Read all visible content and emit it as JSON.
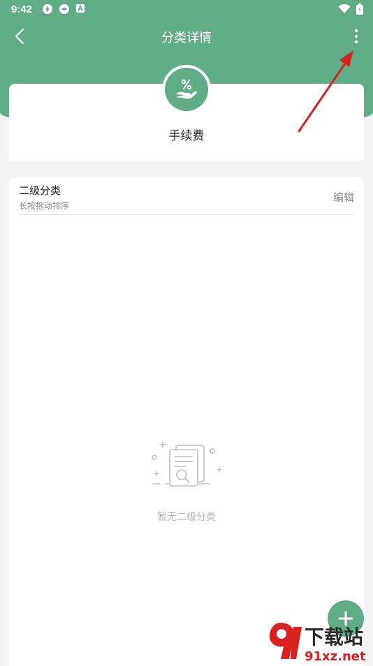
{
  "status_bar": {
    "time": "9:42"
  },
  "nav": {
    "title": "分类详情"
  },
  "category": {
    "name": "手续费",
    "icon": "hand-percent-icon"
  },
  "subcategories": {
    "title": "二级分类",
    "hint": "长按拖动排序",
    "edit_label": "编辑",
    "empty_text": "暂无二级分类"
  },
  "watermark": {
    "main": "下载站",
    "url": "91xz.net"
  },
  "colors": {
    "primary": "#5fac87",
    "annotation": "#d9201e"
  }
}
